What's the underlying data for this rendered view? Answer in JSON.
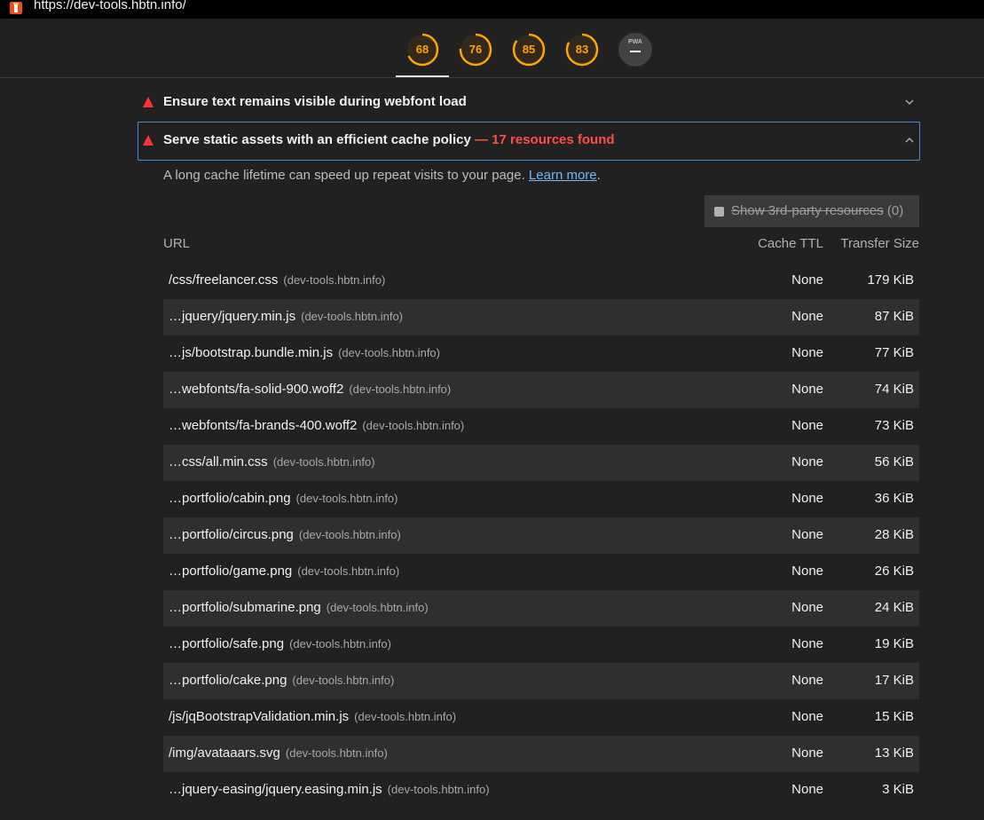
{
  "browser": {
    "url": "https://dev-tools.hbtn.info/"
  },
  "scores": [
    {
      "value": "68",
      "fraction": 0.68,
      "color": "#ffa400"
    },
    {
      "value": "76",
      "fraction": 0.76,
      "color": "#ffa400"
    },
    {
      "value": "85",
      "fraction": 0.85,
      "color": "#ffa400"
    },
    {
      "value": "83",
      "fraction": 0.83,
      "color": "#ffa400"
    }
  ],
  "pwa": {
    "label": "PWA",
    "icon": "pwa-dash-icon"
  },
  "audits": {
    "webfont": {
      "title": "Ensure text remains visible during webfont load",
      "icon": "fail-triangle-icon"
    },
    "cache": {
      "title": "Serve static assets with an efficient cache policy",
      "display_value": "— 17 resources found",
      "description": "A long cache lifetime can speed up repeat visits to your page.",
      "learn_more": "Learn more",
      "period": "."
    }
  },
  "filter": {
    "label": "Show 3rd-party resources",
    "count": "(0)"
  },
  "table": {
    "headers": {
      "url": "URL",
      "ttl": "Cache TTL",
      "size": "Transfer Size"
    },
    "rows": [
      {
        "url": "/css/freelancer.css",
        "host": "(dev-tools.hbtn.info)",
        "ttl": "None",
        "size": "179 KiB"
      },
      {
        "url": "…jquery/jquery.min.js",
        "host": "(dev-tools.hbtn.info)",
        "ttl": "None",
        "size": "87 KiB"
      },
      {
        "url": "…js/bootstrap.bundle.min.js",
        "host": "(dev-tools.hbtn.info)",
        "ttl": "None",
        "size": "77 KiB"
      },
      {
        "url": "…webfonts/fa-solid-900.woff2",
        "host": "(dev-tools.hbtn.info)",
        "ttl": "None",
        "size": "74 KiB"
      },
      {
        "url": "…webfonts/fa-brands-400.woff2",
        "host": "(dev-tools.hbtn.info)",
        "ttl": "None",
        "size": "73 KiB"
      },
      {
        "url": "…css/all.min.css",
        "host": "(dev-tools.hbtn.info)",
        "ttl": "None",
        "size": "56 KiB"
      },
      {
        "url": "…portfolio/cabin.png",
        "host": "(dev-tools.hbtn.info)",
        "ttl": "None",
        "size": "36 KiB"
      },
      {
        "url": "…portfolio/circus.png",
        "host": "(dev-tools.hbtn.info)",
        "ttl": "None",
        "size": "28 KiB"
      },
      {
        "url": "…portfolio/game.png",
        "host": "(dev-tools.hbtn.info)",
        "ttl": "None",
        "size": "26 KiB"
      },
      {
        "url": "…portfolio/submarine.png",
        "host": "(dev-tools.hbtn.info)",
        "ttl": "None",
        "size": "24 KiB"
      },
      {
        "url": "…portfolio/safe.png",
        "host": "(dev-tools.hbtn.info)",
        "ttl": "None",
        "size": "19 KiB"
      },
      {
        "url": "…portfolio/cake.png",
        "host": "(dev-tools.hbtn.info)",
        "ttl": "None",
        "size": "17 KiB"
      },
      {
        "url": "/js/jqBootstrapValidation.min.js",
        "host": "(dev-tools.hbtn.info)",
        "ttl": "None",
        "size": "15 KiB"
      },
      {
        "url": "/img/avataaars.svg",
        "host": "(dev-tools.hbtn.info)",
        "ttl": "None",
        "size": "13 KiB"
      },
      {
        "url": "…jquery-easing/jquery.easing.min.js",
        "host": "(dev-tools.hbtn.info)",
        "ttl": "None",
        "size": "3 KiB"
      }
    ]
  }
}
